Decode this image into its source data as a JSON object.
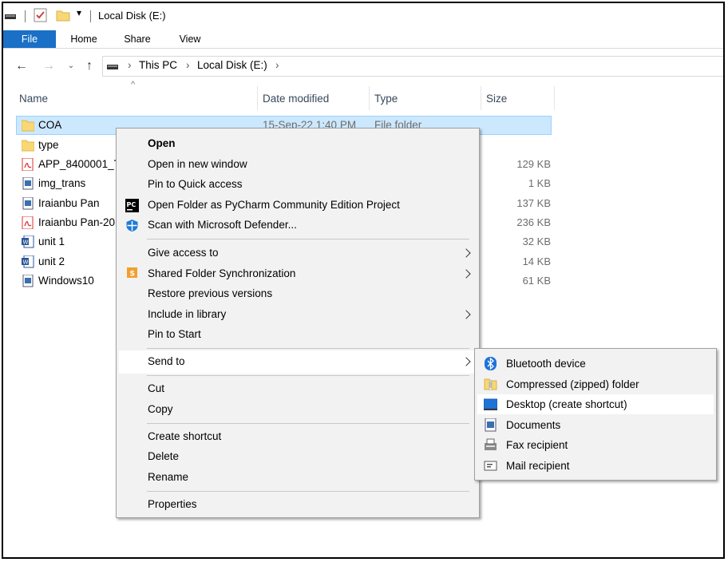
{
  "window": {
    "title": "Local Disk (E:)"
  },
  "ribbon": {
    "tabs": [
      "File",
      "Home",
      "Share",
      "View"
    ]
  },
  "address": {
    "crumbs": [
      "This PC",
      "Local Disk (E:)"
    ]
  },
  "columns": {
    "name": "Name",
    "date": "Date modified",
    "type": "Type",
    "size": "Size"
  },
  "files": [
    {
      "name": "COA",
      "date": "15-Sep-22 1:40 PM",
      "type": "File folder",
      "size": "",
      "icon": "folder-icon"
    },
    {
      "name": "type",
      "date": "",
      "type": "",
      "size": "",
      "icon": "folder-icon"
    },
    {
      "name": "APP_8400001_T",
      "date": "",
      "type": "",
      "size": "129 KB",
      "icon": "pdf-icon"
    },
    {
      "name": "img_trans",
      "date": "",
      "type": "",
      "size": "1 KB",
      "icon": "document-icon"
    },
    {
      "name": "Iraianbu Pan",
      "date": "",
      "type": "",
      "size": "137 KB",
      "icon": "document-icon"
    },
    {
      "name": "Iraianbu Pan-20",
      "date": "",
      "type": "",
      "size": "236 KB",
      "icon": "pdf-icon"
    },
    {
      "name": "unit 1",
      "date": "",
      "type": "",
      "size": "32 KB",
      "icon": "word-icon"
    },
    {
      "name": "unit 2",
      "date": "",
      "type": "",
      "size": "14 KB",
      "icon": "word-icon"
    },
    {
      "name": "Windows10",
      "date": "",
      "type": "",
      "size": "61 KB",
      "icon": "document-icon"
    }
  ],
  "context_menu": {
    "open": "Open",
    "open_new_window": "Open in new window",
    "pin_quick_access": "Pin to Quick access",
    "open_pycharm": "Open Folder as PyCharm Community Edition Project",
    "scan_defender": "Scan with Microsoft Defender...",
    "give_access": "Give access to",
    "shared_sync": "Shared Folder Synchronization",
    "restore_versions": "Restore previous versions",
    "include_library": "Include in library",
    "pin_start": "Pin to Start",
    "send_to": "Send to",
    "cut": "Cut",
    "copy": "Copy",
    "create_shortcut": "Create shortcut",
    "delete": "Delete",
    "rename": "Rename",
    "properties": "Properties"
  },
  "send_to_menu": {
    "bluetooth": "Bluetooth device",
    "compressed": "Compressed (zipped) folder",
    "desktop": "Desktop (create shortcut)",
    "documents": "Documents",
    "fax": "Fax recipient",
    "mail": "Mail recipient"
  },
  "colors": {
    "file_tab": "#1a6fc7",
    "selection": "#cce8ff",
    "menu_bg": "#f2f2f2"
  }
}
